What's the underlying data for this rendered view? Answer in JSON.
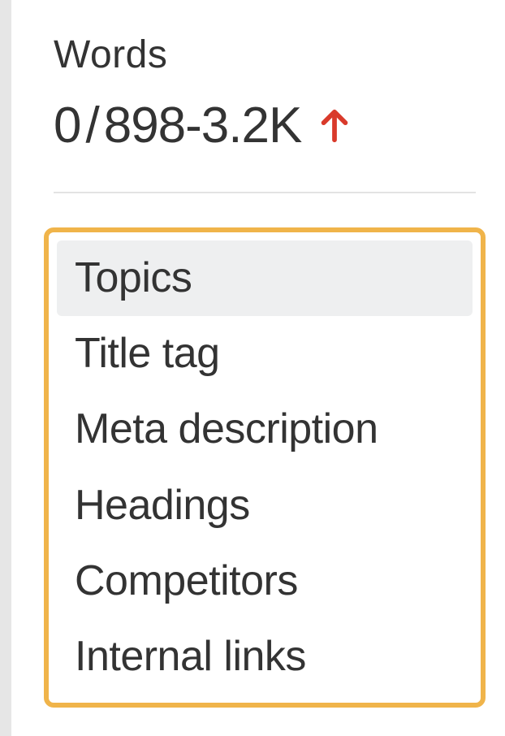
{
  "words": {
    "label": "Words",
    "current": "0",
    "separator": "/",
    "range": "898-3.2K",
    "trend": "up",
    "trend_color": "#d93a2b"
  },
  "menu": {
    "items": [
      {
        "label": "Topics",
        "selected": true
      },
      {
        "label": "Title tag",
        "selected": false
      },
      {
        "label": "Meta description",
        "selected": false
      },
      {
        "label": "Headings",
        "selected": false
      },
      {
        "label": "Competitors",
        "selected": false
      },
      {
        "label": "Internal links",
        "selected": false
      }
    ]
  }
}
